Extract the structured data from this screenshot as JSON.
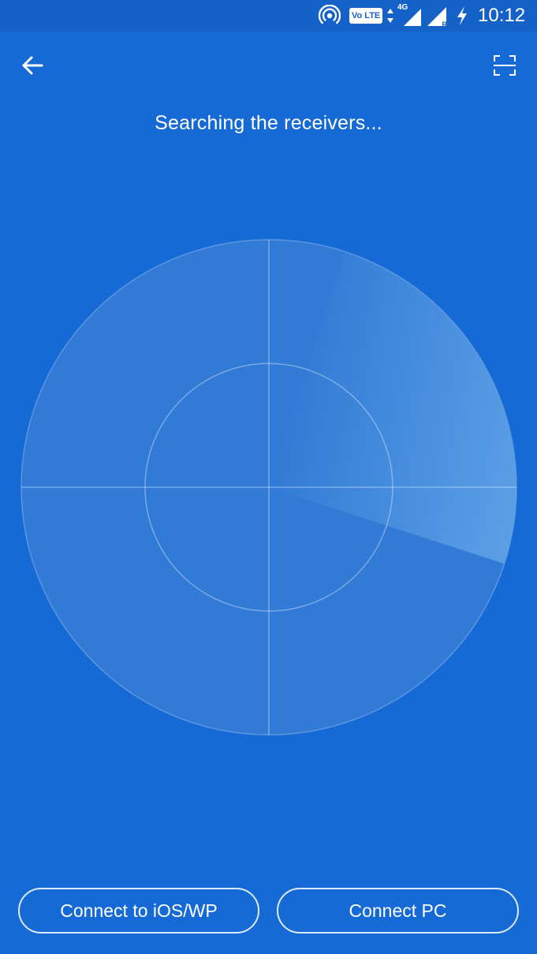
{
  "status_bar": {
    "volte_label": "Vo LTE",
    "network_label": "4G",
    "roaming_label": "R",
    "time": "10:12",
    "icons": [
      "hotspot-icon",
      "volte-icon",
      "data-arrows-icon",
      "signal-4g-icon",
      "signal-roaming-icon",
      "charging-icon"
    ]
  },
  "toolbar": {
    "back_icon": "arrow-left-icon",
    "scan_icon": "scan-frame-icon"
  },
  "main": {
    "status_text": "Searching the receivers..."
  },
  "radar": {
    "sweep_start_deg": 18,
    "sweep_span_deg": 90
  },
  "buttons": {
    "connect_ios": "Connect to iOS/WP",
    "connect_pc": "Connect PC"
  },
  "colors": {
    "background": "#166ad5",
    "status_bar": "#1461c8",
    "radar_fill": "#317bd6",
    "sweep_highlight": "#5ea2e6"
  }
}
